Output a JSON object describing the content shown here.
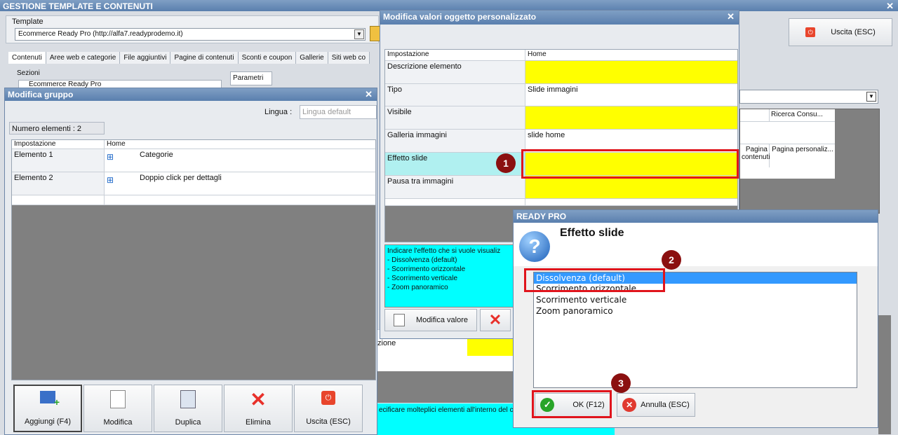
{
  "main": {
    "title": "GESTIONE TEMPLATE E CONTENUTI",
    "template_label": "Template",
    "template_value": "Ecommerce Ready Pro (http://alfa7.readyprodemo.it)",
    "tabs": [
      "Contenuti",
      "Aree web e categorie",
      "File aggiuntivi",
      "Pagine di contenuti",
      "Sconti e coupon",
      "Gallerie",
      "Siti web co"
    ],
    "sezioni_label": "Sezioni",
    "sezioni_item": "Ecommerce Ready Pro",
    "parametri_tab": "Parametri",
    "exit_label": "Uscita (ESC)",
    "bg_grid_headers": [
      "Ricerca Consu..."
    ],
    "bg_grid_cells": [
      "Pagina contenuti",
      "Pagina personaliz..."
    ],
    "bg_bottom_label": "zione",
    "bg_bottom_text": "ecificare molteplici elementi all'interno del c"
  },
  "group_dialog": {
    "title": "Modifica gruppo",
    "lingua_label": "Lingua :",
    "lingua_placeholder": "Lingua default",
    "count": "Numero elementi : 2",
    "headers": [
      "Impostazione",
      "Home"
    ],
    "rows": [
      {
        "setting": "Elemento 1",
        "value": "Categorie"
      },
      {
        "setting": "Elemento 2",
        "value": "Doppio click per dettagli"
      }
    ],
    "buttons": {
      "add": "Aggiungi (F4)",
      "edit": "Modifica",
      "duplicate": "Duplica",
      "delete": "Elimina",
      "exit": "Uscita (ESC)"
    }
  },
  "object_dialog": {
    "title": "Modifica valori oggetto personalizzato",
    "headers": [
      "Impostazione",
      "Home"
    ],
    "rows": [
      {
        "setting": "Descrizione elemento",
        "value": ""
      },
      {
        "setting": "Tipo",
        "value": "Slide immagini"
      },
      {
        "setting": "Visibile",
        "value": ""
      },
      {
        "setting": "Galleria immagini",
        "value": "slide home"
      },
      {
        "setting": "Effetto slide",
        "value": ""
      },
      {
        "setting": "Pausa tra immagini",
        "value": ""
      }
    ],
    "help_text": "Indicare l'effetto che si vuole visualiz\n- Dissolvenza (default)\n- Scorrimento orizzontale\n- Scorrimento verticale\n- Zoom panoramico",
    "edit_value_button": "Modifica valore"
  },
  "choice_dialog": {
    "title": "READY PRO",
    "heading": "Effetto slide",
    "options": [
      "Dissolvenza (default)",
      "Scorrimento orizzontale",
      "Scorrimento verticale",
      "Zoom panoramico"
    ],
    "selected_index": 0,
    "ok_label": "OK (F12)",
    "cancel_label": "Annulla (ESC)"
  },
  "callouts": [
    "1",
    "2",
    "3"
  ],
  "colors": {
    "highlight_yellow": "#ffff00",
    "help_cyan": "#00ffff",
    "selection_blue": "#3399ff",
    "callout_red": "#e0141c",
    "callout_badge": "#8b1010"
  }
}
